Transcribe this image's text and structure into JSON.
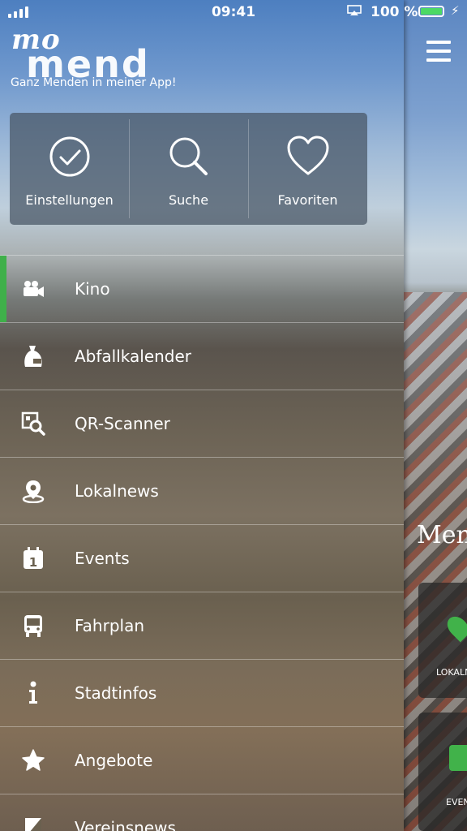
{
  "status_bar": {
    "time": "09:41",
    "battery": "100 %",
    "battery_color": "#4cd964"
  },
  "app": {
    "logo_top": "mo",
    "logo_bottom": "mend",
    "tagline": "Ganz Menden in meiner App!"
  },
  "quick_actions": [
    {
      "label": "Einstellungen",
      "icon": "checkmark-circle-icon"
    },
    {
      "label": "Suche",
      "icon": "search-icon"
    },
    {
      "label": "Favoriten",
      "icon": "heart-icon"
    }
  ],
  "menu": {
    "accent_color": "#3fb04a",
    "items": [
      {
        "label": "Kino",
        "icon": "movie-camera-icon",
        "active": true
      },
      {
        "label": "Abfallkalender",
        "icon": "garbage-bag-icon",
        "active": false
      },
      {
        "label": "QR-Scanner",
        "icon": "qr-scan-icon",
        "active": false
      },
      {
        "label": "Lokalnews",
        "icon": "location-pin-icon",
        "active": false
      },
      {
        "label": "Events",
        "icon": "calendar-icon",
        "active": false
      },
      {
        "label": "Fahrplan",
        "icon": "bus-icon",
        "active": false
      },
      {
        "label": "Stadtinfos",
        "icon": "info-icon",
        "active": false
      },
      {
        "label": "Angebote",
        "icon": "star-icon",
        "active": false
      },
      {
        "label": "Vereinsnews",
        "icon": "vereinsnews-icon",
        "active": false
      }
    ]
  },
  "background": {
    "title_partial": "Men",
    "tile_labels": [
      "LOKALN",
      "EVEN"
    ]
  }
}
